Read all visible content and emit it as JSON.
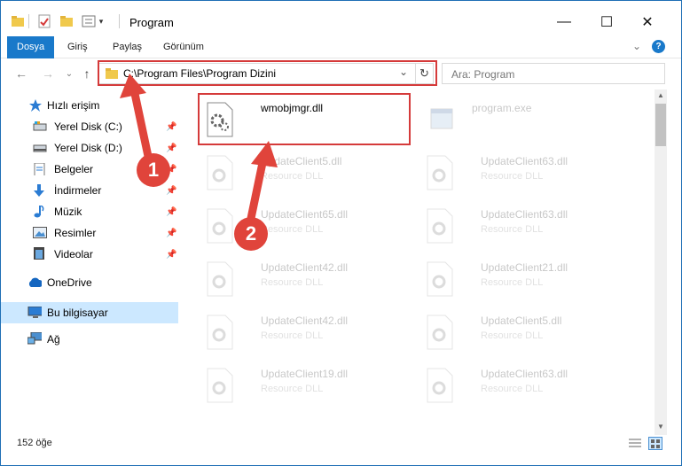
{
  "window": {
    "title": "Program",
    "minimize_glyph": "—",
    "maximize_glyph": "☐",
    "close_glyph": "✕"
  },
  "ribbon": {
    "tabs": [
      "Dosya",
      "Giriş",
      "Paylaş",
      "Görünüm"
    ],
    "help_glyph": "?",
    "expand_glyph": "⌄"
  },
  "address": {
    "path": "C:\\Program Files\\Program Dizini",
    "dropdown_glyph": "⌄",
    "refresh_glyph": "↻",
    "back_glyph": "←",
    "forward_glyph": "→",
    "up_glyph": "↑",
    "recent_glyph": "⌄"
  },
  "search": {
    "placeholder": "Ara: Program"
  },
  "sidebar": {
    "items": [
      {
        "label": "Hızlı erişim",
        "icon": "star-icon"
      },
      {
        "label": "Yerel Disk (C:)",
        "icon": "drive-icon"
      },
      {
        "label": "Yerel Disk (D:)",
        "icon": "drive-icon"
      },
      {
        "label": "Belgeler",
        "icon": "documents-icon"
      },
      {
        "label": "İndirmeler",
        "icon": "download-icon"
      },
      {
        "label": "Müzik",
        "icon": "music-icon"
      },
      {
        "label": "Resimler",
        "icon": "pictures-icon"
      },
      {
        "label": "Videolar",
        "icon": "videos-icon"
      },
      {
        "label": "OneDrive",
        "icon": "cloud-icon"
      },
      {
        "label": "Bu bilgisayar",
        "icon": "computer-icon"
      },
      {
        "label": "Ağ",
        "icon": "network-icon"
      }
    ],
    "pin_glyph": "📌"
  },
  "files": [
    {
      "name": "wmobjmgr.dll",
      "type": ""
    },
    {
      "name": "program.exe",
      "type": ""
    },
    {
      "name": "UpdateClient5.dll",
      "type": "Resource DLL"
    },
    {
      "name": "UpdateClient63.dll",
      "type": "Resource DLL"
    },
    {
      "name": "UpdateClient65.dll",
      "type": "Resource DLL"
    },
    {
      "name": "UpdateClient63.dll",
      "type": "Resource DLL"
    },
    {
      "name": "UpdateClient42.dll",
      "type": "Resource DLL"
    },
    {
      "name": "UpdateClient21.dll",
      "type": "Resource DLL"
    },
    {
      "name": "UpdateClient42.dll",
      "type": "Resource DLL"
    },
    {
      "name": "UpdateClient5.dll",
      "type": "Resource DLL"
    },
    {
      "name": "UpdateClient19.dll",
      "type": "Resource DLL"
    },
    {
      "name": "UpdateClient63.dll",
      "type": "Resource DLL"
    }
  ],
  "status": {
    "count": "152 öğe"
  },
  "annotations": {
    "step1": "1",
    "step2": "2"
  },
  "colors": {
    "accent": "#1979ca",
    "highlight_red": "#d53a3a",
    "selected_nav": "#cce8ff"
  }
}
